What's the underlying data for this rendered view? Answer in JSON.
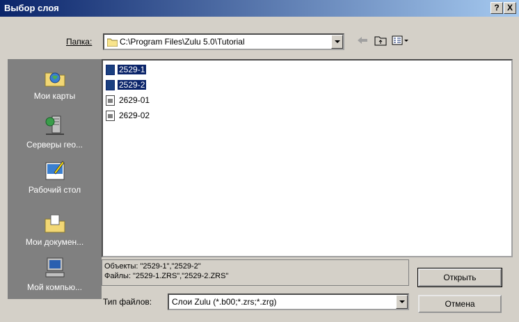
{
  "window": {
    "title": "Выбор слоя",
    "help_label": "?",
    "close_label": "X"
  },
  "toolbar": {
    "folder_label": "Папка:",
    "folder_path": "C:\\Program Files\\Zulu 5.0\\Tutorial",
    "icons": [
      "back-arrow-icon",
      "up-folder-icon",
      "view-menu-icon"
    ]
  },
  "places": [
    {
      "label": "Мои карты",
      "icon": "my-maps-icon"
    },
    {
      "label": "Серверы гео...",
      "icon": "geo-servers-icon"
    },
    {
      "label": "Рабочий стол",
      "icon": "desktop-icon"
    },
    {
      "label": "Мои докумен...",
      "icon": "my-documents-icon"
    },
    {
      "label": "Мой компью...",
      "icon": "my-computer-icon"
    }
  ],
  "files": [
    {
      "name": "2529-1",
      "selected": true,
      "icon": "layer-file-icon"
    },
    {
      "name": "2529-2",
      "selected": true,
      "icon": "layer-file-icon"
    },
    {
      "name": "2629-01",
      "selected": false,
      "icon": "raster-file-icon"
    },
    {
      "name": "2629-02",
      "selected": false,
      "icon": "raster-file-icon"
    }
  ],
  "info": {
    "objects": "Объекты: \"2529-1\",\"2529-2\"",
    "files": "Файлы: \"2529-1.ZRS\",\"2529-2.ZRS\""
  },
  "filetype": {
    "label": "Тип файлов:",
    "value": "Слои Zulu (*.b00;*.zrs;*.zrg)"
  },
  "buttons": {
    "open": "Открыть",
    "cancel": "Отмена"
  },
  "colors": {
    "title_start": "#0a246a",
    "title_end": "#a6caf0",
    "selection": "#0a246a",
    "places_bg": "#808080"
  }
}
